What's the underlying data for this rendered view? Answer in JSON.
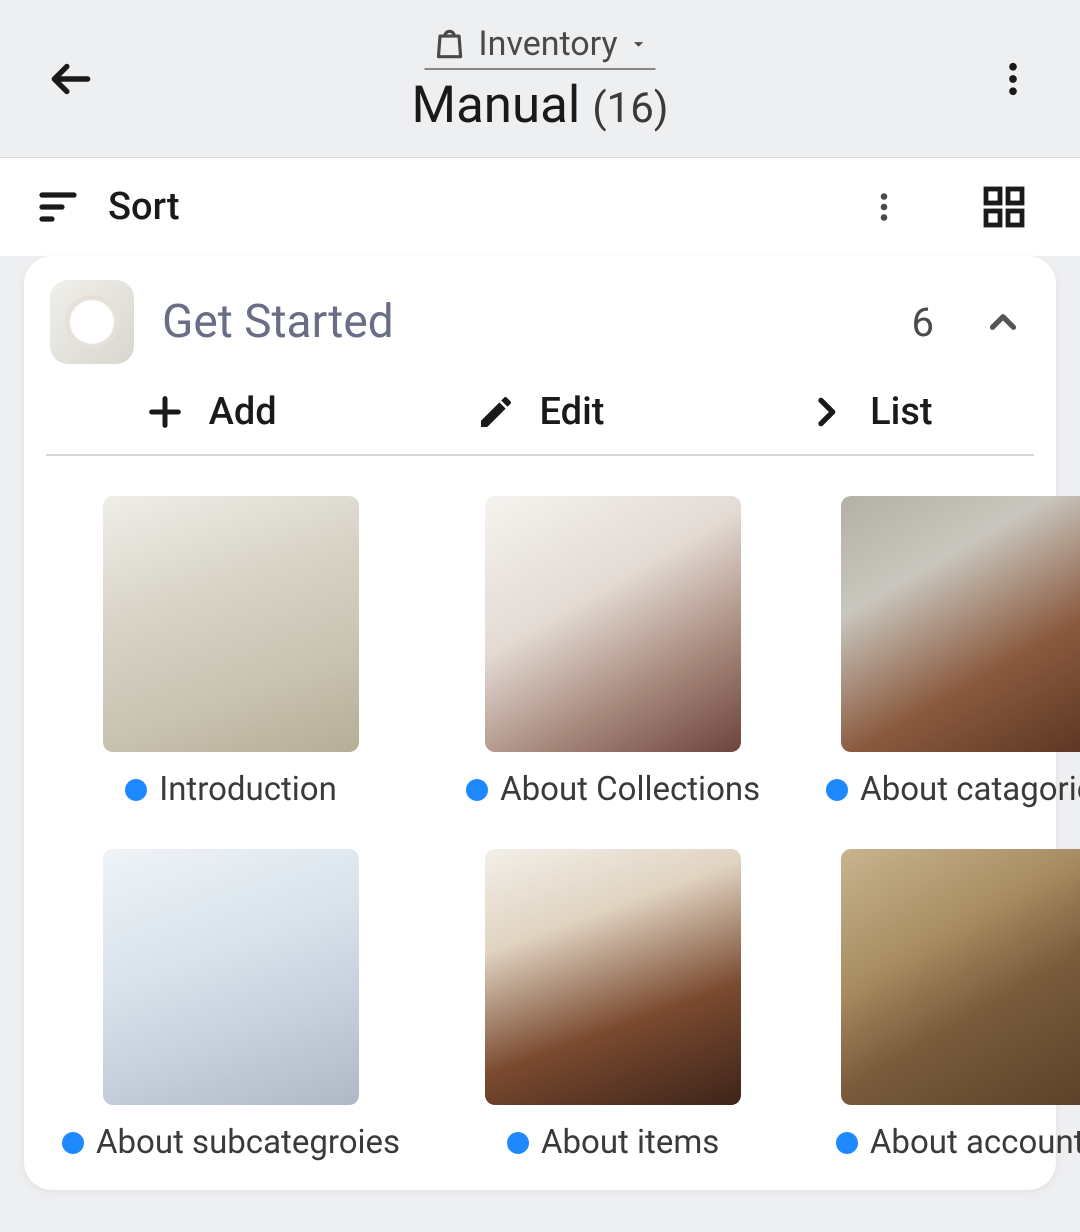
{
  "header": {
    "dropdown_label": "Inventory",
    "title": "Manual",
    "count_text": "(16)"
  },
  "toolbar": {
    "sort_label": "Sort"
  },
  "section": {
    "title": "Get Started",
    "count": "6",
    "actions": {
      "add": "Add",
      "edit": "Edit",
      "list": "List"
    },
    "items": [
      {
        "label": "Introduction",
        "thumb_class": "g1"
      },
      {
        "label": "About Collections",
        "thumb_class": "g2"
      },
      {
        "label": "About catagories",
        "thumb_class": "g3"
      },
      {
        "label": "About subcategroies",
        "thumb_class": "g4"
      },
      {
        "label": "About items",
        "thumb_class": "g5"
      },
      {
        "label": "About accounts",
        "thumb_class": "g6"
      }
    ]
  },
  "colors": {
    "status_dot": "#1e88ff"
  }
}
